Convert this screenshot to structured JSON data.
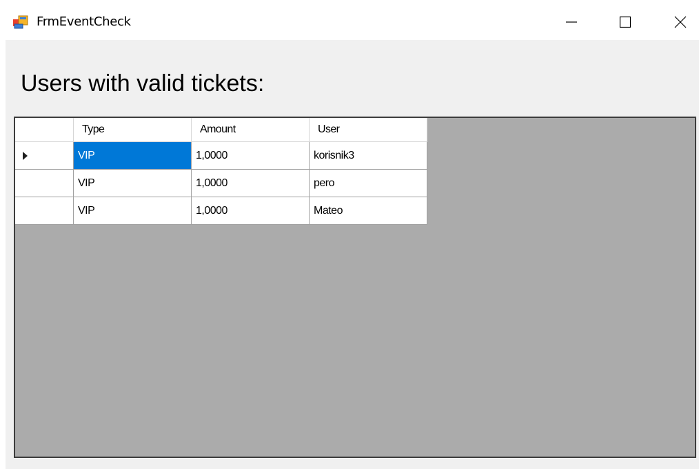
{
  "window": {
    "title": "FrmEventCheck",
    "minimize_icon": "minimize-icon",
    "maximize_icon": "maximize-icon",
    "close_icon": "close-icon"
  },
  "heading": "Users with valid tickets:",
  "grid": {
    "columns": [
      "Type",
      "Amount",
      "User"
    ],
    "rows": [
      {
        "type": "VIP",
        "amount": "1,0000",
        "user": "korisnik3",
        "current": true,
        "selected_column": "Type"
      },
      {
        "type": "VIP",
        "amount": "1,0000",
        "user": "pero"
      },
      {
        "type": "VIP",
        "amount": "1,0000",
        "user": "Mateo"
      }
    ],
    "selection_color": "#0078d7",
    "background_color": "#ababab"
  }
}
